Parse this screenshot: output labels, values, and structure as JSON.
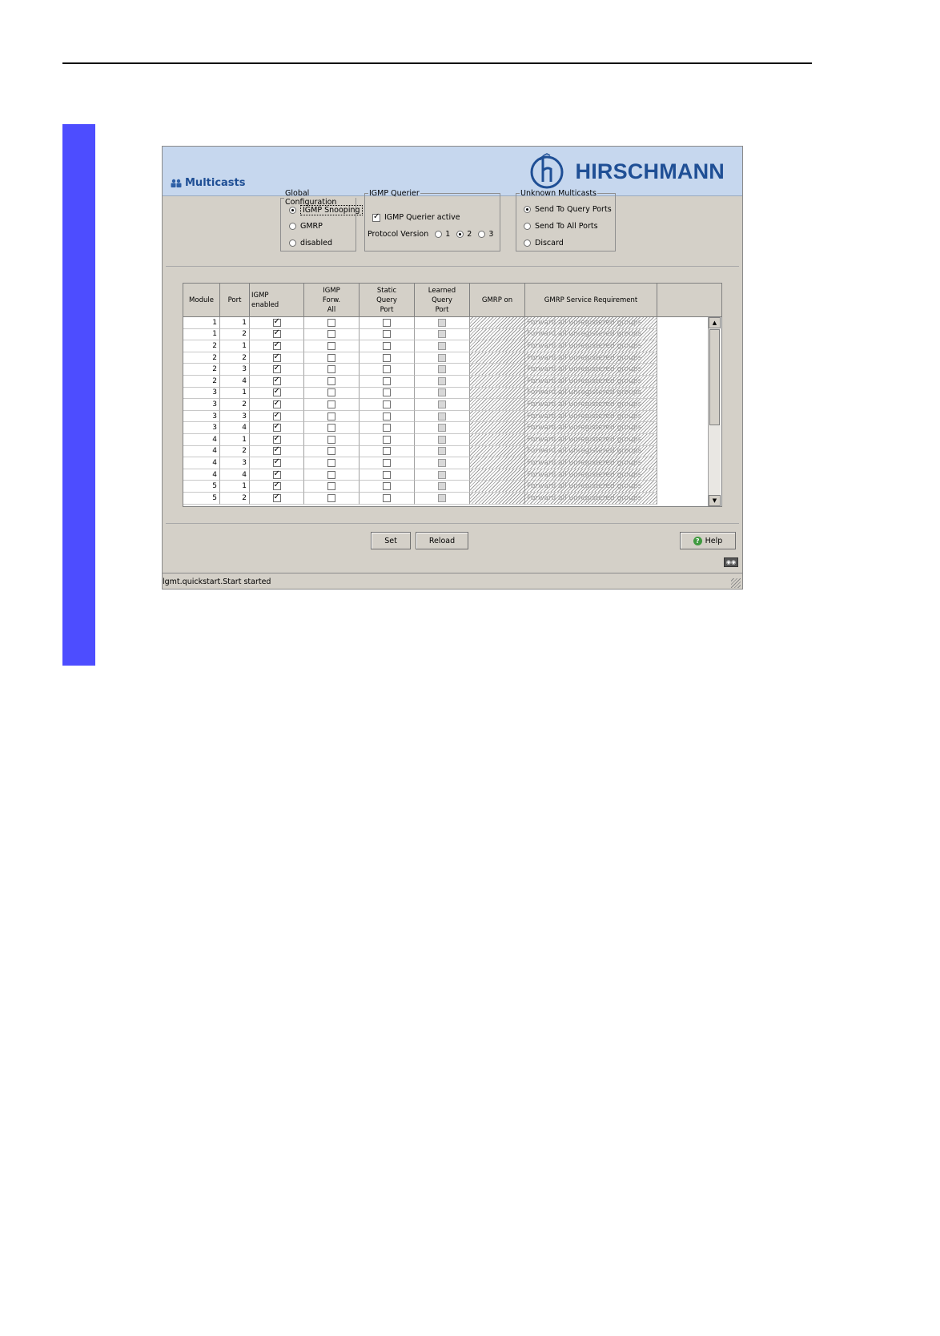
{
  "page": {
    "side_bar_color": "#4d4dff"
  },
  "header": {
    "title": "Multicasts",
    "title_icon": "multicast-group-icon",
    "brand_name": "HIRSCHMANN",
    "brand_logo": "hirschmann-h-logo-icon"
  },
  "global_config": {
    "legend": "Global Configuration",
    "options": [
      {
        "label": "IGMP Snooping",
        "selected": true
      },
      {
        "label": "GMRP",
        "selected": false
      },
      {
        "label": "disabled",
        "selected": false
      }
    ]
  },
  "igmp_querier": {
    "legend": "IGMP Querier",
    "active_label": "IGMP Querier active",
    "active_checked": true,
    "protocol_version_label": "Protocol Version",
    "versions": [
      {
        "label": "1",
        "selected": false
      },
      {
        "label": "2",
        "selected": true
      },
      {
        "label": "3",
        "selected": false
      }
    ]
  },
  "unknown_multicasts": {
    "legend": "Unknown Multicasts",
    "options": [
      {
        "label": "Send To Query Ports",
        "selected": true
      },
      {
        "label": "Send To All Ports",
        "selected": false
      },
      {
        "label": "Discard",
        "selected": false
      }
    ]
  },
  "table": {
    "headers": {
      "module": "Module",
      "port": "Port",
      "igmp_enabled": [
        "IGMP",
        "enabled"
      ],
      "igmp_forw_all": [
        "IGMP",
        "Forw.",
        "All"
      ],
      "static_query_port": [
        "Static",
        "Query",
        "Port"
      ],
      "learned_query_port": [
        "Learned",
        "Query",
        "Port"
      ],
      "gmrp_on": "GMRP on",
      "gmrp_service": "GMRP Service Requirement"
    },
    "service_text": "Forward all unregistered groups",
    "rows": [
      {
        "module": "1",
        "port": "1"
      },
      {
        "module": "1",
        "port": "2"
      },
      {
        "module": "2",
        "port": "1"
      },
      {
        "module": "2",
        "port": "2"
      },
      {
        "module": "2",
        "port": "3"
      },
      {
        "module": "2",
        "port": "4"
      },
      {
        "module": "3",
        "port": "1"
      },
      {
        "module": "3",
        "port": "2"
      },
      {
        "module": "3",
        "port": "3"
      },
      {
        "module": "3",
        "port": "4"
      },
      {
        "module": "4",
        "port": "1"
      },
      {
        "module": "4",
        "port": "2"
      },
      {
        "module": "4",
        "port": "3"
      },
      {
        "module": "4",
        "port": "4"
      },
      {
        "module": "5",
        "port": "1"
      },
      {
        "module": "5",
        "port": "2"
      }
    ]
  },
  "buttons": {
    "set": "Set",
    "reload": "Reload",
    "help": "Help"
  },
  "status": "lgmt.quickstart.Start started"
}
